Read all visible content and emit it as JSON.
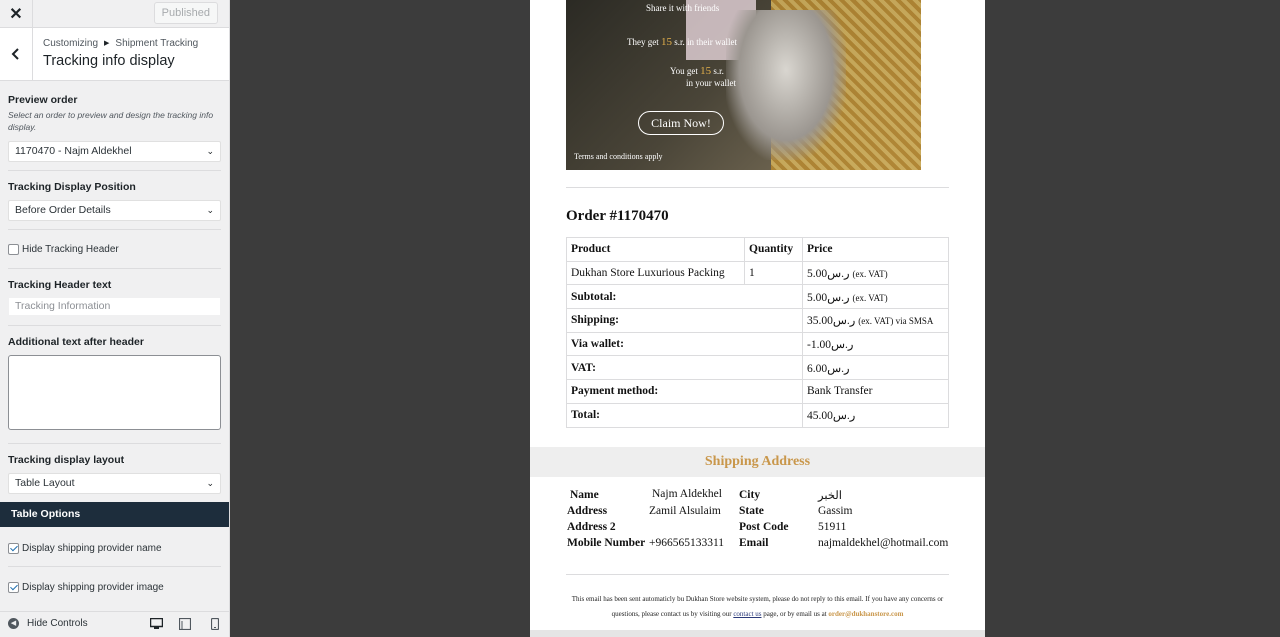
{
  "topbar": {
    "close_glyph": "✕",
    "publish_label": "Published"
  },
  "section": {
    "breadcrumb_root": "Customizing",
    "breadcrumb_current": "Shipment Tracking",
    "title": "Tracking info display"
  },
  "controls": {
    "preview_order": {
      "label": "Preview order",
      "description": "Select an order to preview and design the tracking info display.",
      "value": "1170470 - Najm Aldekhel"
    },
    "display_position": {
      "label": "Tracking Display Position",
      "value": "Before Order Details"
    },
    "hide_header": {
      "label": "Hide Tracking Header",
      "checked": false
    },
    "header_text": {
      "label": "Tracking Header text",
      "placeholder": "Tracking Information"
    },
    "additional_text": {
      "label": "Additional text after header",
      "value": ""
    },
    "layout": {
      "label": "Tracking display layout",
      "value": "Table Layout"
    },
    "table_options": {
      "label": "Table Options"
    },
    "provider_name": {
      "label": "Display shipping provider name",
      "checked": true
    },
    "provider_image": {
      "label": "Display shipping provider image",
      "checked": true
    }
  },
  "footer": {
    "hide_controls_label": "Hide Controls"
  },
  "email": {
    "banner": {
      "line1": "Share it with friends",
      "line2_pre": "They get ",
      "line2_accent": "15",
      "line2_post": " s.r. in their wallet",
      "line3_pre": "You get ",
      "line3_accent": "15",
      "line3_post": " s.r.",
      "line4": "in your wallet",
      "claim": "Claim Now!",
      "terms": "Terms and conditions apply"
    },
    "order_title": "Order #1170470",
    "order_table": {
      "headers": [
        "Product",
        "Quantity",
        "Price"
      ],
      "item": {
        "product": "Dukhan Store Luxurious Packing",
        "qty": "1",
        "price": "5.00ر.س",
        "price_note": "(ex. VAT)"
      },
      "rows": [
        {
          "label": "Subtotal:",
          "value": "5.00ر.س",
          "note": "(ex. VAT)"
        },
        {
          "label": "Shipping:",
          "value": "35.00ر.س",
          "note": "(ex. VAT)  via SMSA"
        },
        {
          "label": "Via wallet:",
          "value": "-1.00ر.س",
          "note": ""
        },
        {
          "label": "VAT:",
          "value": "6.00ر.س",
          "note": ""
        },
        {
          "label": "Payment method:",
          "value": "Bank Transfer",
          "note": ""
        },
        {
          "label": "Total:",
          "value": "45.00ر.س",
          "note": ""
        }
      ]
    },
    "shipping_title": "Shipping Address",
    "address": {
      "name_label": "Name",
      "name": "Najm Aldekhel",
      "city_label": "City",
      "city": "الخبر",
      "address_label": "Address",
      "address": "Zamil Alsulaim",
      "state_label": "State",
      "state": "Gassim",
      "address2_label": "Address 2",
      "address2": "",
      "postcode_label": "Post Code",
      "postcode": "51911",
      "mobile_label": "Mobile Number",
      "mobile": "+966565133311",
      "email_label": "Email",
      "email": "najmaldekhel@hotmail.com"
    },
    "footer_note": {
      "line1": "This email has been sent automaticly bu Dukhan Store website system, please do not reply to this email. If you have any concerns or",
      "line2_pre": "questions, please contact us by visiting our ",
      "link": "contact us",
      "line2_mid": " page, or by email us at ",
      "email": "order@dukhanstore.com"
    }
  }
}
